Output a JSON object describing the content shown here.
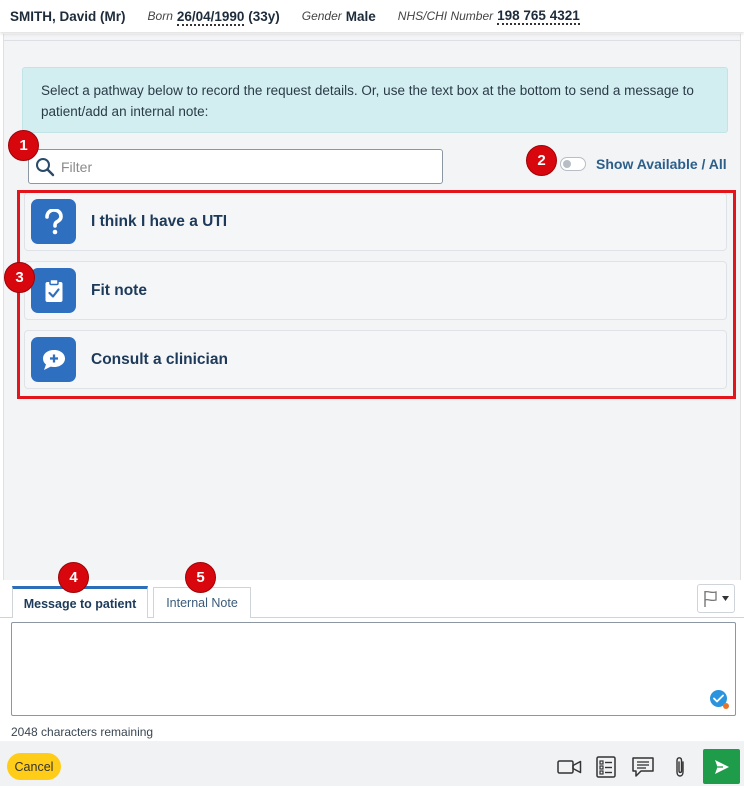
{
  "header": {
    "name": "SMITH, David (Mr)",
    "born_label": "Born",
    "born_value": "26/04/1990",
    "age": "(33y)",
    "gender_label": "Gender",
    "gender_value": "Male",
    "nhs_label": "NHS/CHI Number",
    "nhs_value": "198 765 4321"
  },
  "info": {
    "text": "Select a pathway below to record the request details. Or, use the text box at the bottom to send a message to patient/add an internal note:"
  },
  "filter": {
    "placeholder": "Filter",
    "value": ""
  },
  "toggle": {
    "label": "Show Available / All",
    "on": false
  },
  "pathways": [
    {
      "label": "I think I have a UTI",
      "icon": "question-icon"
    },
    {
      "label": "Fit note",
      "icon": "clipboard-check-icon"
    },
    {
      "label": "Consult a clinician",
      "icon": "chat-plus-icon"
    }
  ],
  "markers": [
    "1",
    "2",
    "3",
    "4",
    "5"
  ],
  "tabs": [
    {
      "label": "Message to patient",
      "active": true
    },
    {
      "label": "Internal Note",
      "active": false
    }
  ],
  "compose": {
    "value": "",
    "chars_remaining": "2048 characters remaining"
  },
  "footer": {
    "cancel_label": "Cancel",
    "icons": [
      "video-icon",
      "form-list-icon",
      "message-template-icon",
      "paperclip-icon"
    ]
  },
  "colors": {
    "accent": "#2f6fbf",
    "highlight": "#e3141b",
    "marker": "#d7070d",
    "send": "#1e9c49",
    "cancel": "#ffcc17",
    "info_bg": "#d3eef0"
  }
}
